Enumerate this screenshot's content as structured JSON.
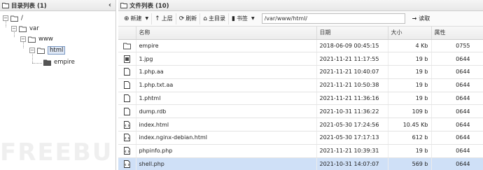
{
  "left_panel": {
    "title": "目录列表 (1)",
    "collapse_glyph": "‹",
    "tree": [
      {
        "label": "/",
        "toggle": "−"
      },
      {
        "label": "var",
        "toggle": "−"
      },
      {
        "label": "www",
        "toggle": "−"
      },
      {
        "label": "html",
        "toggle": "−"
      },
      {
        "label": "empire",
        "toggle": ""
      }
    ]
  },
  "right_panel": {
    "title": "文件列表 (10)",
    "toolbar": {
      "new_label": "新建",
      "up_label": "上层",
      "refresh_label": "刷新",
      "home_label": "主目录",
      "bookmark_label": "书签",
      "path_value": "/var/www/html/",
      "read_label": "读取"
    },
    "columns": [
      "名称",
      "日期",
      "大小",
      "属性"
    ],
    "rows": [
      {
        "icon": "folder",
        "name": "empire",
        "date": "2018-06-09 00:45:15",
        "size": "4 Kb",
        "perm": "0755"
      },
      {
        "icon": "image",
        "name": "1.jpg",
        "date": "2021-11-21 11:17:55",
        "size": "19 b",
        "perm": "0644"
      },
      {
        "icon": "file",
        "name": "1.php.aa",
        "date": "2021-11-21 10:40:07",
        "size": "19 b",
        "perm": "0644"
      },
      {
        "icon": "file",
        "name": "1.php.txt.aa",
        "date": "2021-11-21 10:50:38",
        "size": "19 b",
        "perm": "0644"
      },
      {
        "icon": "file",
        "name": "1.phtml",
        "date": "2021-11-21 11:36:16",
        "size": "19 b",
        "perm": "0644"
      },
      {
        "icon": "file",
        "name": "dump.rdb",
        "date": "2021-10-31 11:36:22",
        "size": "109 b",
        "perm": "0644"
      },
      {
        "icon": "code",
        "name": "index.html",
        "date": "2021-05-30 17:24:56",
        "size": "10.45 Kb",
        "perm": "0644"
      },
      {
        "icon": "code",
        "name": "index.nginx-debian.html",
        "date": "2021-05-30 17:17:13",
        "size": "612 b",
        "perm": "0644"
      },
      {
        "icon": "code",
        "name": "phpinfo.php",
        "date": "2021-11-21 10:39:31",
        "size": "19 b",
        "perm": "0644"
      },
      {
        "icon": "code",
        "name": "shell.php",
        "date": "2021-10-31 14:07:07",
        "size": "569 b",
        "perm": "0644"
      }
    ],
    "selected_row": 9
  },
  "colors": {
    "selected_row_bg": "#cfe0f7",
    "header_bg": "#ececec"
  }
}
